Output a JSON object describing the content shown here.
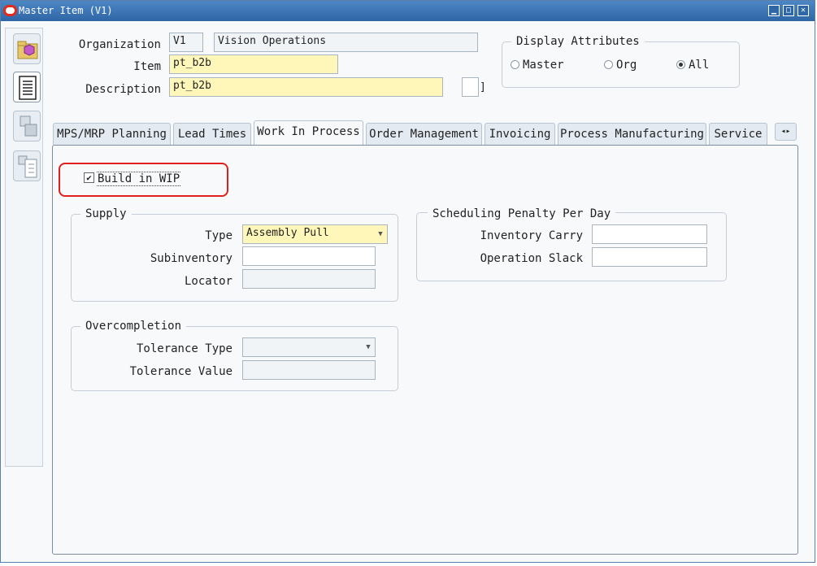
{
  "window": {
    "title": "Master Item (V1)"
  },
  "header": {
    "organization_label": "Organization",
    "organization_code": "V1",
    "organization_name": "Vision Operations",
    "item_label": "Item",
    "item_value": "pt_b2b",
    "description_label": "Description",
    "description_value": "pt_b2b",
    "bracket": "]"
  },
  "display_attributes": {
    "title": "Display Attributes",
    "options": [
      "Master",
      "Org",
      "All"
    ],
    "selected": "All"
  },
  "tabs": [
    "MPS/MRP Planning",
    "Lead Times",
    "Work In Process",
    "Order Management",
    "Invoicing",
    "Process Manufacturing",
    "Service"
  ],
  "active_tab": "Work In Process",
  "tab_scroll_icon": "◂▸",
  "wip": {
    "build_in_wip_label": "Build in WIP",
    "build_in_wip_checked": true,
    "supply": {
      "title": "Supply",
      "type_label": "Type",
      "type_value": "Assembly Pull",
      "subinventory_label": "Subinventory",
      "subinventory_value": "",
      "locator_label": "Locator",
      "locator_value": ""
    },
    "overcompletion": {
      "title": "Overcompletion",
      "tolerance_type_label": "Tolerance Type",
      "tolerance_type_value": "",
      "tolerance_value_label": "Tolerance Value",
      "tolerance_value_value": ""
    },
    "scheduling": {
      "title": "Scheduling Penalty Per Day",
      "inventory_carry_label": "Inventory Carry",
      "inventory_carry_value": "",
      "operation_slack_label": "Operation Slack",
      "operation_slack_value": ""
    }
  },
  "colors": {
    "title_bar": "#2f67a6",
    "required_field": "#fff7ba",
    "highlight_ring": "#e0201c"
  }
}
